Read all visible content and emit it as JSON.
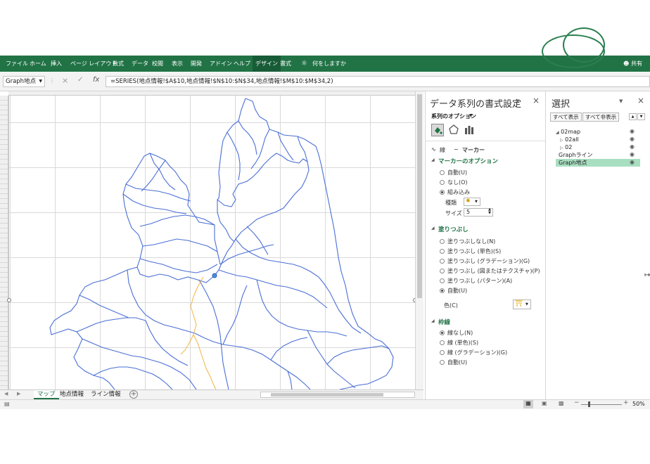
{
  "ribbon": {
    "tabs": [
      "ファイル",
      "ホーム",
      "挿入",
      "ページ レイアウト",
      "数式",
      "データ",
      "校閲",
      "表示",
      "開発",
      "アドイン",
      "ヘルプ",
      "デザイン",
      "書式"
    ],
    "tell_me": "何をしますか",
    "share": "共有",
    "active_tab": "デザイン"
  },
  "formula_bar": {
    "name_box": "Graph地点",
    "fx": "fx",
    "formula": "=SERIES(地点情報!$A$10,地点情報!$N$10:$N$34,地点情報!$M$10:$M$34,2)"
  },
  "sheet_tabs": [
    "マップ",
    "地点情報",
    "ライン情報"
  ],
  "active_sheet": "マップ",
  "format_pane": {
    "title": "データ系列の書式設定",
    "series_options": "系列のオプション",
    "tabs": {
      "line": "線",
      "marker": "マーカー"
    },
    "marker_options": {
      "heading": "マーカーのオプション",
      "options": [
        "自動(U)",
        "なし(O)",
        "組み込み"
      ],
      "selected": "組み込み",
      "type_label": "種類",
      "size_label": "サイズ",
      "size_value": "5"
    },
    "fill": {
      "heading": "塗りつぶし",
      "options": [
        "塗りつぶしなし(N)",
        "塗りつぶし (単色)(S)",
        "塗りつぶし (グラデーション)(G)",
        "塗りつぶし (図またはテクスチャ)(P)",
        "塗りつぶし (パターン)(A)",
        "自動(U)"
      ],
      "selected": "自動(U)",
      "color_label": "色(C)"
    },
    "border": {
      "heading": "枠線",
      "options": [
        "線なし(N)",
        "線 (単色)(S)",
        "線 (グラデーション)(G)",
        "自動(U)"
      ],
      "selected": "線なし(N)"
    }
  },
  "selection_pane": {
    "title": "選択",
    "show_all": "すべて表示",
    "hide_all": "すべて非表示",
    "items": [
      {
        "label": "02map",
        "level": 0,
        "selected": false
      },
      {
        "label": "02all",
        "level": 1,
        "selected": false
      },
      {
        "label": "02",
        "level": 1,
        "selected": false
      },
      {
        "label": "Graphライン",
        "level": 0,
        "selected": false
      },
      {
        "label": "Graph地点",
        "level": 0,
        "selected": true
      }
    ]
  },
  "status": {
    "zoom": "50%"
  },
  "colors": {
    "excel_green": "#217346",
    "map_line": "#4a6fd6",
    "route_line": "#f2b441",
    "selected_item": "#a9dfc1"
  },
  "icons": [
    "lightbulb-icon",
    "person-icon",
    "fx-icon",
    "paint-bucket-icon",
    "pentagon-icon",
    "bar-chart-icon",
    "eye-icon",
    "close-icon",
    "plus-icon"
  ]
}
